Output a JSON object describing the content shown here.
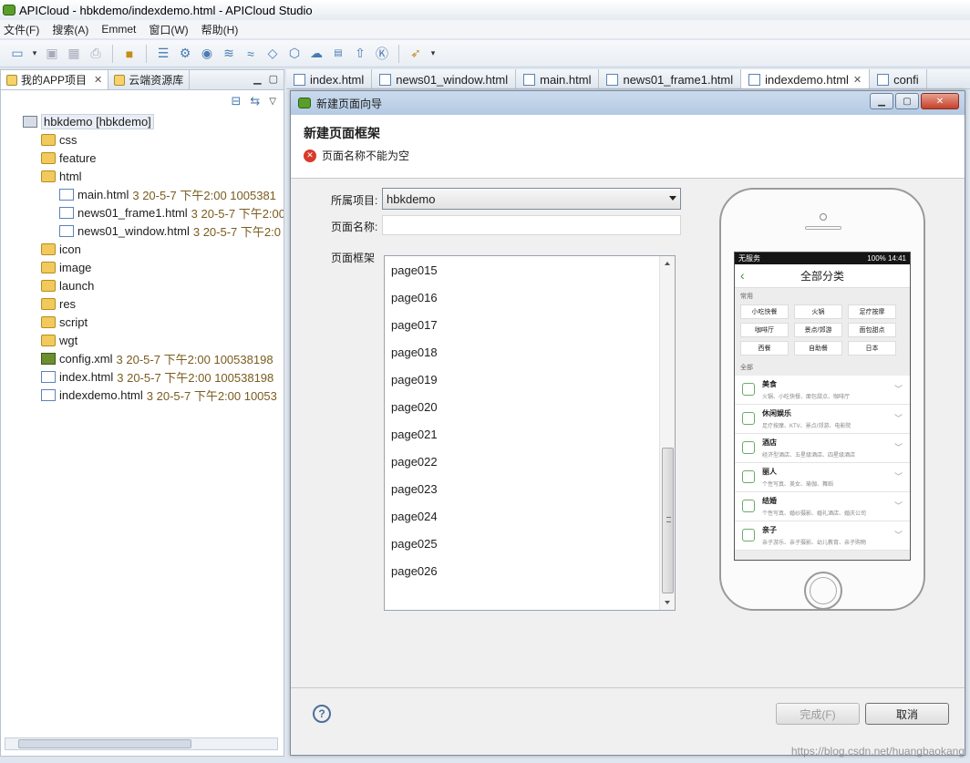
{
  "window": {
    "title": "APICloud - hbkdemo/indexdemo.html - APICloud Studio"
  },
  "menu": [
    "文件(F)",
    "搜索(A)",
    "Emmet",
    "窗口(W)",
    "帮助(H)"
  ],
  "toolbar_icons": [
    "new-icon",
    "save-icon",
    "save-all-icon",
    "print-icon",
    "package-icon",
    "document-icon",
    "gear-icon",
    "eye-icon",
    "layers-icon",
    "wifi-icon",
    "tag-icon",
    "cube-icon",
    "cloud-icon",
    "doc-icon",
    "upload-icon",
    "ok-icon",
    "rocket-icon"
  ],
  "left_panel": {
    "tabs": [
      {
        "label": "我的APP项目",
        "closable": "✕"
      },
      {
        "label": "云端资源库"
      }
    ],
    "tree": [
      {
        "label": "hbkdemo [hbkdemo]",
        "meta": "",
        "type": "project",
        "depth": 0,
        "selected": true
      },
      {
        "label": "css",
        "meta": "",
        "type": "folder",
        "depth": 1
      },
      {
        "label": "feature",
        "meta": "",
        "type": "folder",
        "depth": 1
      },
      {
        "label": "html",
        "meta": "",
        "type": "folder",
        "depth": 1
      },
      {
        "label": "main.html",
        "meta": "3  20-5-7 下午2:00  1005381",
        "type": "html",
        "depth": 2
      },
      {
        "label": "news01_frame1.html",
        "meta": "3  20-5-7 下午2:00",
        "type": "html",
        "depth": 2
      },
      {
        "label": "news01_window.html",
        "meta": "3  20-5-7 下午2:0",
        "type": "html",
        "depth": 2
      },
      {
        "label": "icon",
        "meta": "",
        "type": "folder",
        "depth": 1
      },
      {
        "label": "image",
        "meta": "",
        "type": "folder",
        "depth": 1
      },
      {
        "label": "launch",
        "meta": "",
        "type": "folder",
        "depth": 1
      },
      {
        "label": "res",
        "meta": "",
        "type": "folder",
        "depth": 1
      },
      {
        "label": "script",
        "meta": "",
        "type": "folder",
        "depth": 1
      },
      {
        "label": "wgt",
        "meta": "",
        "type": "folder",
        "depth": 1
      },
      {
        "label": "config.xml",
        "meta": "3  20-5-7 下午2:00  100538198",
        "type": "xml",
        "depth": 1
      },
      {
        "label": "index.html",
        "meta": "3  20-5-7 下午2:00  100538198",
        "type": "html",
        "depth": 1
      },
      {
        "label": "indexdemo.html",
        "meta": "3  20-5-7 下午2:00  10053",
        "type": "html",
        "depth": 1
      }
    ]
  },
  "editor_tabs": [
    {
      "label": "index.html",
      "active": false
    },
    {
      "label": "news01_window.html",
      "active": false
    },
    {
      "label": "main.html",
      "active": false
    },
    {
      "label": "news01_frame1.html",
      "active": false
    },
    {
      "label": "indexdemo.html",
      "active": true
    },
    {
      "label": "confi",
      "active": false
    }
  ],
  "wizard": {
    "title": "新建页面向导",
    "header_title": "新建页面框架",
    "error_message": "页面名称不能为空",
    "project_label": "所属项目:",
    "project_value": "hbkdemo",
    "name_label": "页面名称:",
    "name_value": "",
    "frame_label": "页面框架",
    "frames": [
      "page015",
      "page016",
      "page017",
      "page018",
      "page019",
      "page020",
      "page021",
      "page022",
      "page023",
      "page024",
      "page025",
      "page026"
    ],
    "finish_label": "完成(F)",
    "cancel_label": "取消",
    "help_glyph": "?"
  },
  "preview": {
    "status_left": "无服务",
    "status_right": "100% 14:41",
    "nav_title": "全部分类",
    "section_common": "常用",
    "chips": [
      "小吃快餐",
      "火锅",
      "足疗按摩",
      "咖啡厅",
      "景点/郊游",
      "面包甜点",
      "西餐",
      "自助餐",
      "日本"
    ],
    "section_all": "全部",
    "categories": [
      {
        "name": "美食",
        "desc": "火锅、小吃快餐、面包甜点、咖啡厅"
      },
      {
        "name": "休闲娱乐",
        "desc": "足疗按摩、KTV、景点/郊游、电影院"
      },
      {
        "name": "酒店",
        "desc": "经济型酒店、五星级酒店、四星级酒店"
      },
      {
        "name": "丽人",
        "desc": "个性写真、美女、瑜伽、舞蹈"
      },
      {
        "name": "结婚",
        "desc": "个性写真、婚纱摄影、婚礼酒店、婚庆公司"
      },
      {
        "name": "亲子",
        "desc": "亲子游乐、亲子摄影、幼儿教育、亲子购物"
      }
    ]
  },
  "watermark": "https://blog.csdn.net/huangbaokang"
}
